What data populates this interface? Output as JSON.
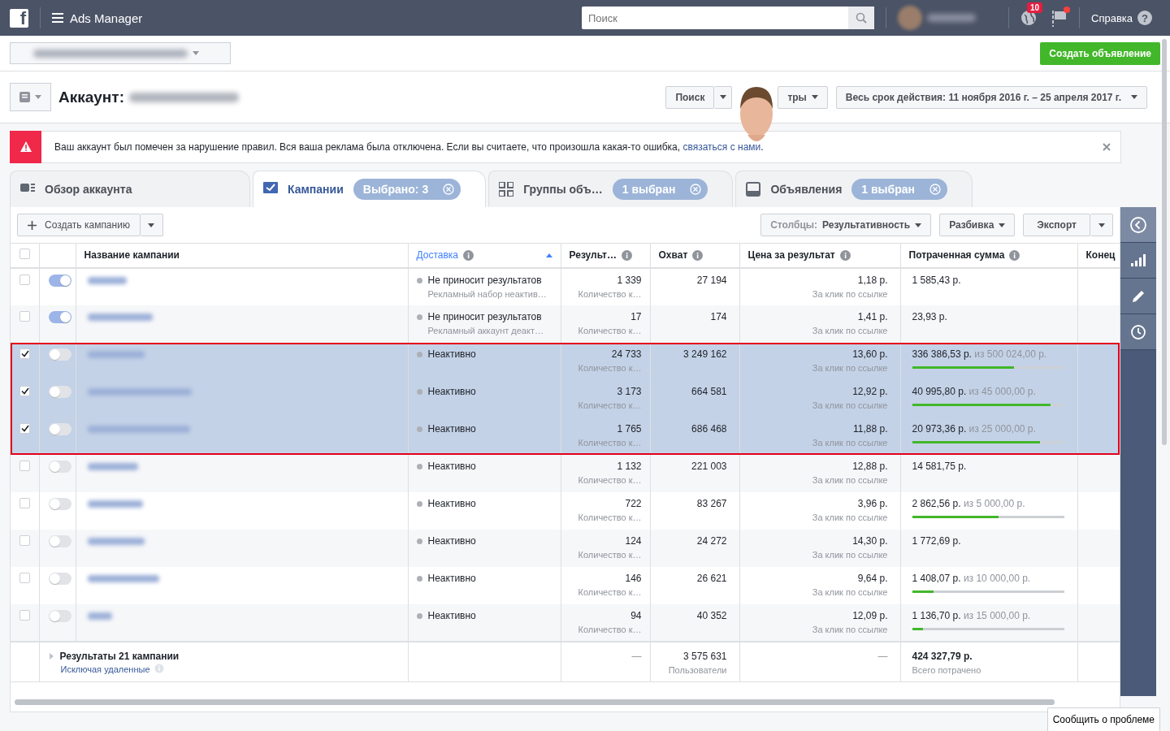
{
  "topbar": {
    "logo": "f",
    "app_title": "Ads Manager",
    "search": {
      "placeholder": "Поиск"
    },
    "notifications_badge": "10",
    "flag_alert": true,
    "help": {
      "label": "Справка",
      "icon": "?"
    }
  },
  "create_ad_button": "Создать объявление",
  "account": {
    "label": "Аккаунт:",
    "search_button": "Поиск",
    "filters_button": "тры",
    "date_range": "Весь срок действия: 11 ноября 2016 г. – 25 апреля 2017 г."
  },
  "alert": {
    "text": "Ваш аккаунт был помечен за нарушение правил. Вся ваша реклама была отключена. Если вы считаете, что произошла какая-то ошибка, ",
    "link": "связаться с нами",
    "end": "."
  },
  "tabs": [
    {
      "kind": "overview",
      "label": "Обзор аккаунта",
      "selected": false
    },
    {
      "kind": "campaigns",
      "label": "Кампании",
      "badge": "Выбрано: 3",
      "selected": true
    },
    {
      "kind": "groups",
      "label": "Группы объ…",
      "badge": "1 выбран",
      "selected": false
    },
    {
      "kind": "ads",
      "label": "Объявления",
      "badge": "1 выбран",
      "selected": false
    }
  ],
  "toolbar": {
    "create_campaign": "Создать кампанию",
    "columns_label": "Столбцы:",
    "columns_value": "Результативность",
    "breakdown": "Разбивка",
    "export": "Экспорт"
  },
  "table": {
    "select_all": false,
    "columns": [
      {
        "label": "Название кампании",
        "info": false,
        "sorted": false
      },
      {
        "label": "Доставка",
        "info": true,
        "sorted": true
      },
      {
        "label": "Результ…",
        "info": true,
        "sorted": false
      },
      {
        "label": "Охват",
        "info": true,
        "sorted": false
      },
      {
        "label": "Цена за результат",
        "info": true,
        "sorted": false
      },
      {
        "label": "Потраченная сумма",
        "info": true,
        "sorted": false
      },
      {
        "label": "Конец",
        "sorted": false
      }
    ],
    "rows": [
      {
        "selected": false,
        "on": true,
        "delivery": "Не приносит результатов",
        "delivery_note": "Рекламный набор неактив…",
        "results": "1 339",
        "results_note": "Количество к…",
        "reach": "27 194",
        "cost": "1,18 р.",
        "cost_note": "За клик по ссылке",
        "spent": "1 585,43 р."
      },
      {
        "selected": false,
        "on": true,
        "delivery": "Не приносит результатов",
        "delivery_note": "Рекламный аккаунт деакт…",
        "results": "17",
        "results_note": "Количество к…",
        "reach": "174",
        "cost": "1,41 р.",
        "cost_note": "За клик по ссылке",
        "spent": "23,93 р."
      },
      {
        "selected": true,
        "on": false,
        "delivery": "Неактивно",
        "results": "24 733",
        "results_note": "Количество к…",
        "reach": "3 249 162",
        "cost": "13,60 р.",
        "cost_note": "За клик по ссылке",
        "spent": "336 386,53 р.",
        "budget": "из 500 024,00 р.",
        "level": 0.67
      },
      {
        "selected": true,
        "on": false,
        "delivery": "Неактивно",
        "results": "3 173",
        "results_note": "Количество к…",
        "reach": "664 581",
        "cost": "12,92 р.",
        "cost_note": "За клик по ссылке",
        "spent": "40 995,80 р.",
        "budget": "из 45 000,00 р.",
        "level": 0.91
      },
      {
        "selected": true,
        "on": false,
        "delivery": "Неактивно",
        "results": "1 765",
        "results_note": "Количество к…",
        "reach": "686 468",
        "cost": "11,88 р.",
        "cost_note": "За клик по ссылке",
        "spent": "20 973,36 р.",
        "budget": "из 25 000,00 р.",
        "level": 0.84
      },
      {
        "selected": false,
        "on": false,
        "delivery": "Неактивно",
        "results": "1 132",
        "results_note": "Количество к…",
        "reach": "221 003",
        "cost": "12,88 р.",
        "cost_note": "За клик по ссылке",
        "spent": "14 581,75 р."
      },
      {
        "selected": false,
        "on": false,
        "delivery": "Неактивно",
        "results": "722",
        "results_note": "Количество к…",
        "reach": "83 267",
        "cost": "3,96 р.",
        "cost_note": "За клик по ссылке",
        "spent": "2 862,56 р.",
        "budget": "из 5 000,00 р.",
        "level": 0.57
      },
      {
        "selected": false,
        "on": false,
        "delivery": "Неактивно",
        "results": "124",
        "results_note": "Количество к…",
        "reach": "24 272",
        "cost": "14,30 р.",
        "cost_note": "За клик по ссылке",
        "spent": "1 772,69 р."
      },
      {
        "selected": false,
        "on": false,
        "delivery": "Неактивно",
        "results": "146",
        "results_note": "Количество к…",
        "reach": "26 621",
        "cost": "9,64 р.",
        "cost_note": "За клик по ссылке",
        "spent": "1 408,07 р.",
        "budget": "из 10 000,00 р.",
        "level": 0.14
      },
      {
        "selected": false,
        "on": false,
        "delivery": "Неактивно",
        "results": "94",
        "results_note": "Количество к…",
        "reach": "40 352",
        "cost": "12,09 р.",
        "cost_note": "За клик по ссылке",
        "spent": "1 136,70 р.",
        "budget": "из 15 000,00 р.",
        "level": 0.07
      }
    ],
    "footer": {
      "title": "Результаты 21 кампании",
      "link": "Исключая удаленные",
      "results": "—",
      "reach": "3 575 631",
      "reach_note": "Пользователи",
      "cost": "—",
      "spent": "424 327,79 р.",
      "spent_note": "Всего потрачено"
    }
  },
  "report_button": "Сообщить о проблеме"
}
